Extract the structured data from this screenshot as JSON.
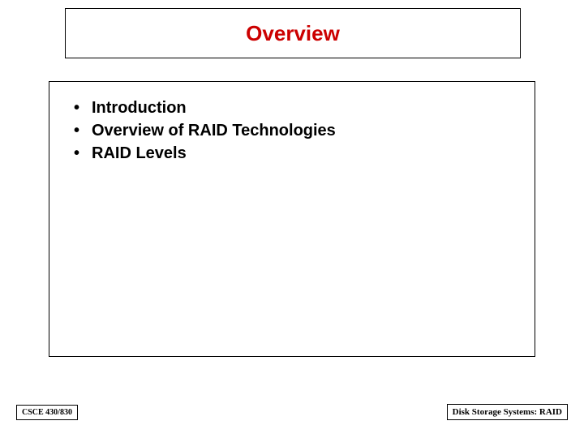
{
  "title": "Overview",
  "bullets": {
    "0": "Introduction",
    "1": "Overview of RAID Technologies",
    "2": "RAID Levels"
  },
  "footer": {
    "left": "CSCE 430/830",
    "right": "Disk Storage Systems: RAID"
  }
}
